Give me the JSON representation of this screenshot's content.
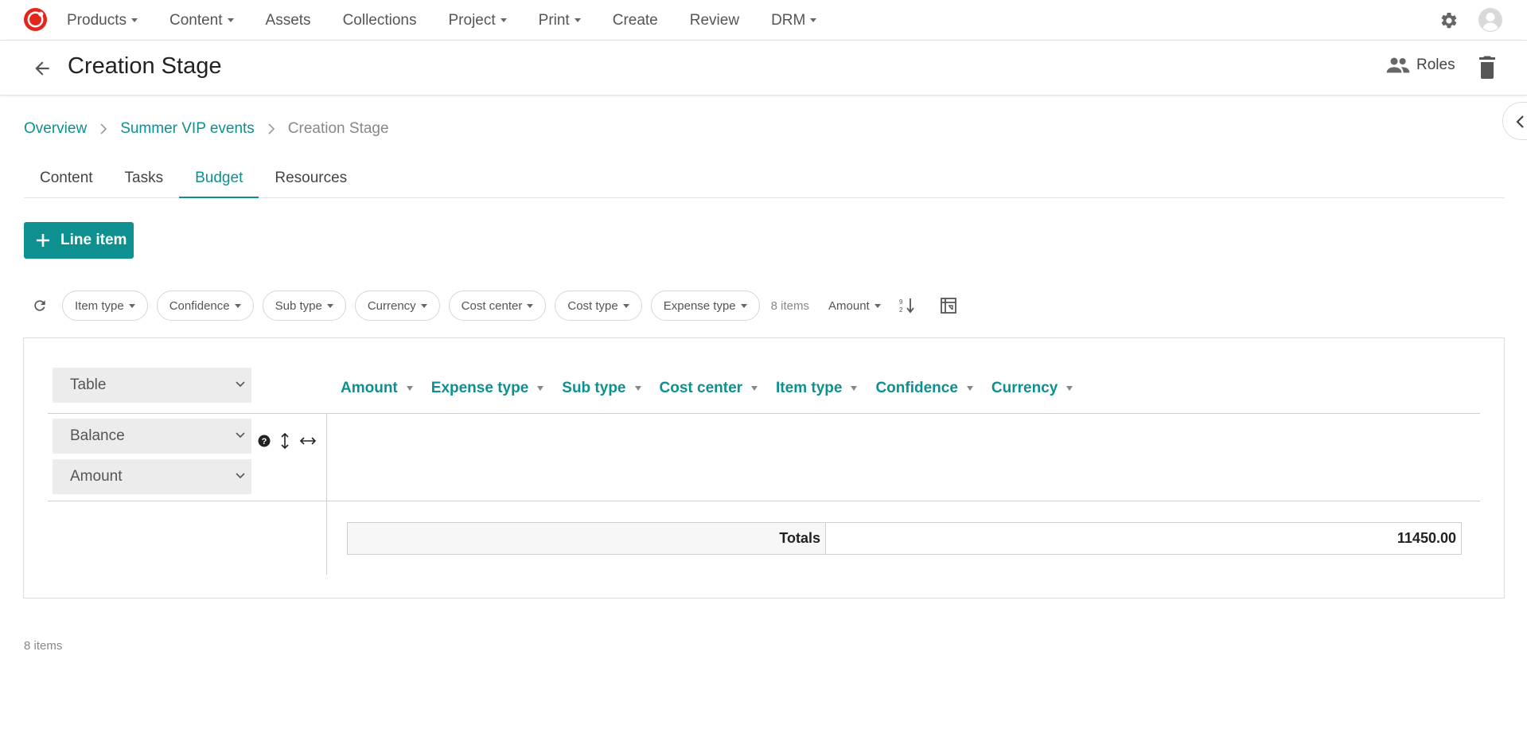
{
  "nav": {
    "items": [
      {
        "label": "Products",
        "dropdown": true
      },
      {
        "label": "Content",
        "dropdown": true
      },
      {
        "label": "Assets",
        "dropdown": false
      },
      {
        "label": "Collections",
        "dropdown": false
      },
      {
        "label": "Project",
        "dropdown": true
      },
      {
        "label": "Print",
        "dropdown": true
      },
      {
        "label": "Create",
        "dropdown": false
      },
      {
        "label": "Review",
        "dropdown": false
      },
      {
        "label": "DRM",
        "dropdown": true
      }
    ],
    "icons": {
      "logo": "brand-logo-icon",
      "settings": "gear-icon",
      "account": "avatar-icon"
    }
  },
  "header": {
    "title": "Creation Stage",
    "roles_label": "Roles"
  },
  "breadcrumb": {
    "items": [
      "Overview",
      "Summer VIP events"
    ],
    "current": "Creation Stage"
  },
  "tabs": {
    "items": [
      "Content",
      "Tasks",
      "Budget",
      "Resources"
    ],
    "active": "Budget"
  },
  "actions": {
    "add_line_item": "Line item"
  },
  "filters": {
    "chips": [
      "Item type",
      "Confidence",
      "Sub type",
      "Currency",
      "Cost center",
      "Cost type",
      "Expense type"
    ],
    "items_count": "8 items",
    "sort_field": "Amount"
  },
  "pivot": {
    "renderer": "Table",
    "aggregator": "Balance",
    "value_field": "Amount",
    "columns": [
      "Amount",
      "Expense type",
      "Sub type",
      "Cost center",
      "Item type",
      "Confidence",
      "Currency"
    ],
    "totals_label": "Totals",
    "totals_value": "11450.00"
  },
  "footer": {
    "items_count": "8 items"
  },
  "colors": {
    "accent": "#0e9090",
    "brand_red": "#e3251c"
  }
}
